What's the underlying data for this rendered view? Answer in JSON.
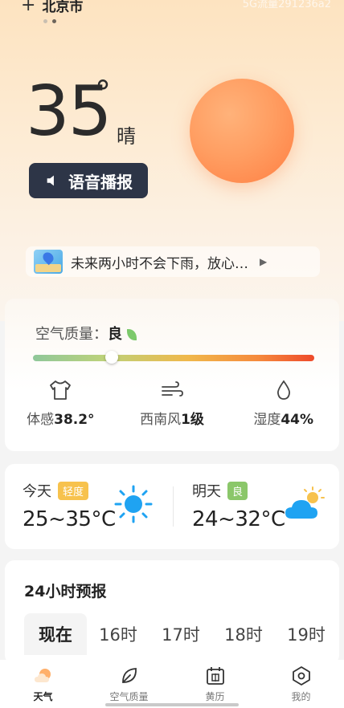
{
  "header": {
    "plus_icon": "+",
    "city": "北京市",
    "watermark": "5G流量291236a2",
    "page_dots": 2,
    "active_dot": 1
  },
  "current": {
    "temperature": "35",
    "degree_symbol": "°",
    "condition": "晴",
    "voice_button_label": "语音播报",
    "rain_tip": "未来两小时不会下雨，放心…"
  },
  "air_quality": {
    "label": "空气质量：",
    "level": "良",
    "indicator_position": 0.28,
    "bar_colors": [
      "#8fc79a",
      "#bcd27b",
      "#f0b84b",
      "#f58a3d",
      "#ee4a2b"
    ]
  },
  "metrics": [
    {
      "icon": "shirt-icon",
      "label": "体感",
      "value": "38.2°"
    },
    {
      "icon": "wind-icon",
      "label": "西南风",
      "value": "1级"
    },
    {
      "icon": "droplet-icon",
      "label": "湿度",
      "value": "44%"
    }
  ],
  "forecast": {
    "today": {
      "label": "今天",
      "badge": "轻度",
      "badge_color": "#f7c24d",
      "range": "25~35°C",
      "icon": "sun-icon"
    },
    "tomorrow": {
      "label": "明天",
      "badge": "良",
      "badge_color": "#8bc76a",
      "range": "24~32°C",
      "icon": "cloud-sun-icon"
    }
  },
  "hourly": {
    "title": "24小时预报",
    "tabs": [
      "现在",
      "16时",
      "17时",
      "18时",
      "19时"
    ],
    "active_index": 0
  },
  "tabbar": {
    "items": [
      {
        "label": "天气",
        "icon": "weather-icon",
        "active": true
      },
      {
        "label": "空气质量",
        "icon": "leaf-icon",
        "active": false
      },
      {
        "label": "黄历",
        "icon": "calendar-icon",
        "active": false
      },
      {
        "label": "我的",
        "icon": "profile-hex-icon",
        "active": false
      }
    ]
  },
  "colors": {
    "accent_dark": "#2d3547",
    "sun": "#ff9e62",
    "forecast_sun": "#1fa3f2"
  }
}
